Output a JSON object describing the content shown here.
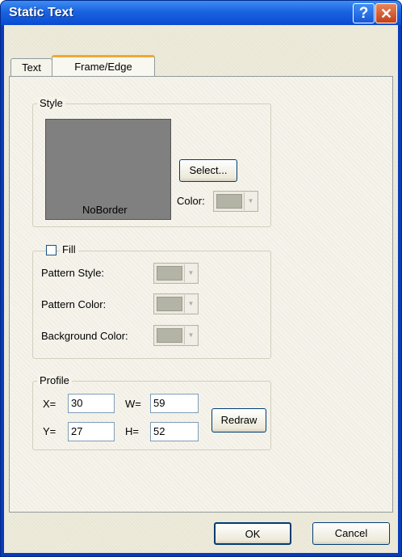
{
  "window": {
    "title": "Static Text"
  },
  "tabs": [
    {
      "label": "Text"
    },
    {
      "label": "Frame/Edge"
    }
  ],
  "style_group": {
    "legend": "Style",
    "preview_label": "NoBorder",
    "select_button": "Select...",
    "color_label": "Color:"
  },
  "fill_group": {
    "label": "Fill",
    "checked": false,
    "pattern_style_label": "Pattern Style:",
    "pattern_color_label": "Pattern Color:",
    "background_color_label": "Background Color:"
  },
  "profile_group": {
    "legend": "Profile",
    "x_label": "X=",
    "x_value": "30",
    "w_label": "W=",
    "w_value": "59",
    "y_label": "Y=",
    "y_value": "27",
    "h_label": "H=",
    "h_value": "52",
    "redraw_button": "Redraw"
  },
  "buttons": {
    "ok": "OK",
    "cancel": "Cancel"
  },
  "colors": {
    "titlebar": "#0a4bd1",
    "preview": "#808080",
    "dialog_bg": "#ece9d8"
  }
}
